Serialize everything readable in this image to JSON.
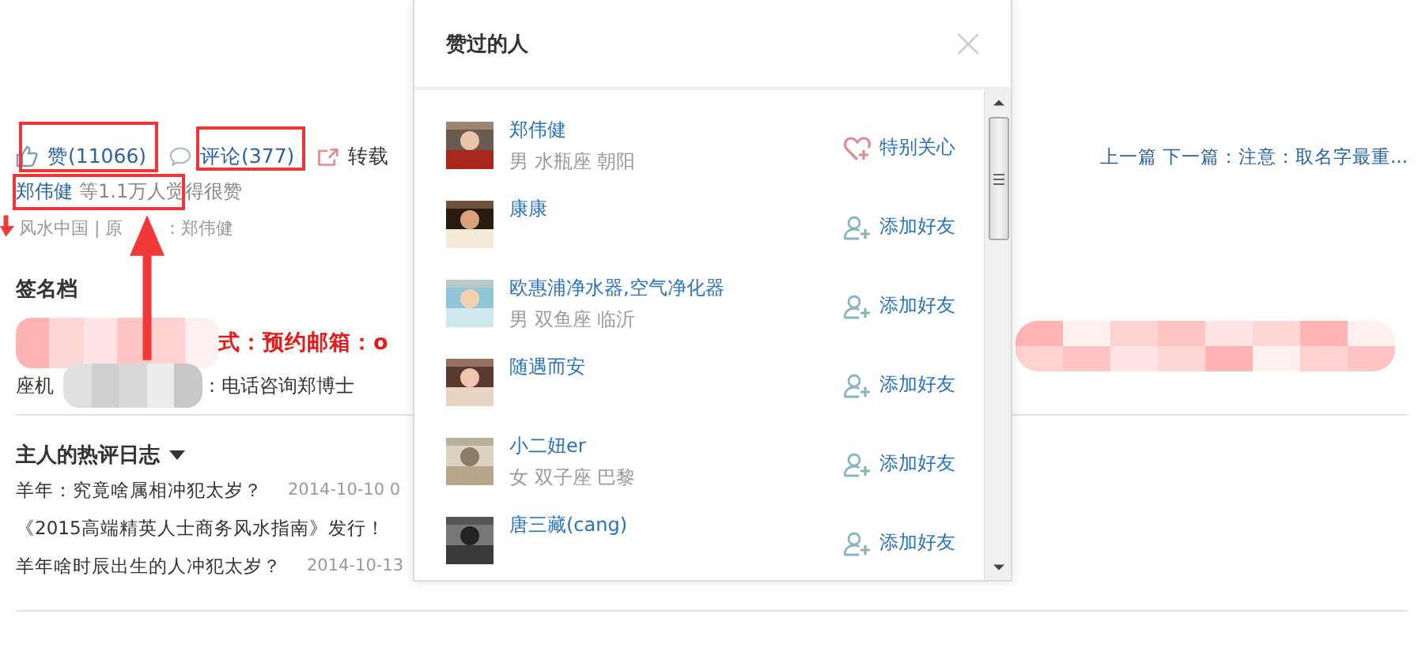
{
  "post": {
    "actions": [
      {
        "kind": "like",
        "label": "赞(11066)"
      },
      {
        "kind": "comment",
        "label": "评论(377)"
      },
      {
        "kind": "share",
        "label": "转载"
      }
    ],
    "liked_by": {
      "name": "郑伟健",
      "text": "等1.1万人觉得很赞"
    },
    "source": [
      "风水中国 | 原",
      "：郑伟健"
    ],
    "nav": "上一篇 下一篇：注意：取名字最重..."
  },
  "signature": {
    "title": "签名档",
    "line_1": "式：预约邮箱：o",
    "line_2_start": "座机",
    "line_2_end": "：电话咨询郑博士"
  },
  "hot_posts": {
    "title": "主人的热评日志",
    "items": [
      {
        "title": "羊年：究竟啥属相冲犯太岁？",
        "date": "2014-10-10 0"
      },
      {
        "title": "《2015高端精英人士商务风水指南》发行！"
      },
      {
        "title": "羊年啥时辰出生的人冲犯太岁？",
        "date": "2014-10-13"
      }
    ]
  },
  "dialog": {
    "title": "赞过的人",
    "close": "×",
    "users": [
      {
        "name": "郑伟健",
        "info": "男 水瓶座 朝阳",
        "action": {
          "kind": "special",
          "label": "特别关心"
        }
      },
      {
        "name": "康康",
        "action": {
          "kind": "add",
          "label": "添加好友"
        }
      },
      {
        "name": "欧惠浦净水器,空气净化器",
        "info": "男 双鱼座 临沂",
        "action": {
          "kind": "add",
          "label": "添加好友"
        }
      },
      {
        "name": "随遇而安",
        "action": {
          "kind": "add",
          "label": "添加好友"
        }
      },
      {
        "name": "小二妞er",
        "info": "女 双子座 巴黎",
        "action": {
          "kind": "add",
          "label": "添加好友"
        }
      },
      {
        "name": "唐三藏(cang)",
        "action": {
          "kind": "add",
          "label": "添加好友"
        }
      }
    ]
  }
}
